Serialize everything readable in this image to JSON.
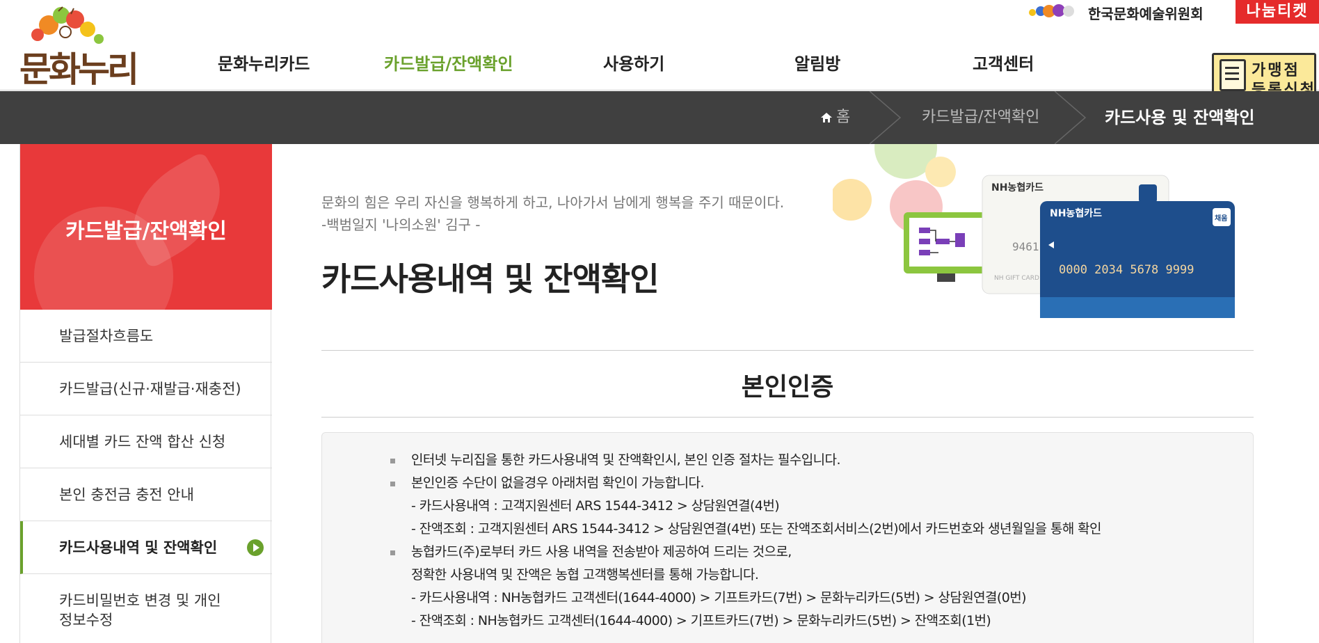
{
  "header": {
    "logo_text": "문화누리",
    "nav": [
      {
        "label": "문화누리카드",
        "active": false
      },
      {
        "label": "카드발급/잔액확인",
        "active": true
      },
      {
        "label": "사용하기",
        "active": false
      },
      {
        "label": "알림방",
        "active": false
      },
      {
        "label": "고객센터",
        "active": false
      }
    ],
    "arts_council": "한국문화예술위원회",
    "nanum_ticket": "나눔티켓",
    "merchant_line1": "가맹점",
    "merchant_line2": "등록신청"
  },
  "breadcrumb": {
    "home": "홈",
    "level1": "카드발급/잔액확인",
    "current": "카드사용 및 잔액확인"
  },
  "sidebar": {
    "title": "카드발급/잔액확인",
    "items": [
      {
        "label": "발급절차흐름도"
      },
      {
        "label": "카드발급(신규·재발급·재충전)"
      },
      {
        "label": "세대별 카드 잔액 합산 신청"
      },
      {
        "label": "본인 충전금 충전 안내"
      },
      {
        "label": "카드사용내역 및 잔액확인"
      },
      {
        "label_line1": "카드비밀번호 변경 및 개인",
        "label_line2": "정보수정"
      }
    ]
  },
  "main": {
    "quote_line1": "문화의 힘은 우리 자신을 행복하게 하고, 나아가서 남에게 행복을 주기 때문이다.",
    "quote_line2": "-백범일지 '나의소원' 김구 -",
    "page_title": "카드사용내역 및 잔액확인",
    "section_title": "본인인증",
    "hero": {
      "card_brand": "NH농협카드",
      "card_badge": "채움",
      "card_number": "0000 2034 5678 9999",
      "back_card_digits": "9461",
      "back_card_label": "NH GIFT CARD"
    },
    "info_lines": [
      "인터넷 누리집을 통한 카드사용내역 및 잔액확인시, 본인 인증 절차는 필수입니다.",
      "본인인증 수단이 없을경우 아래처럼 확인이 가능합니다.",
      "- 카드사용내역 : 고객지원센터 ARS 1544-3412 > 상담원연결(4번)",
      "- 잔액조회 : 고객지원센터 ARS 1544-3412 > 상담원연결(4번) 또는 잔액조회서비스(2번)에서 카드번호와 생년월일을 통해 확인",
      "농협카드(주)로부터 카드 사용 내역을 전송받아 제공하여 드리는 것으로,",
      "정확한 사용내역 및 잔액은 농협 고객행복센터를 통해 가능합니다.",
      "- 카드사용내역 : NH농협카드 고객센터(1644-4000) > 기프트카드(7번) > 문화누리카드(5번) > 상담원연결(0번)",
      "- 잔액조회 : NH농협카드 고객센터(1644-4000) > 기프트카드(7번) > 문화누리카드(5번) > 잔액조회(1번)"
    ]
  },
  "colors": {
    "accent_green": "#6aa12c",
    "sidebar_red": "#e8393a",
    "crumbbar": "#404040"
  }
}
